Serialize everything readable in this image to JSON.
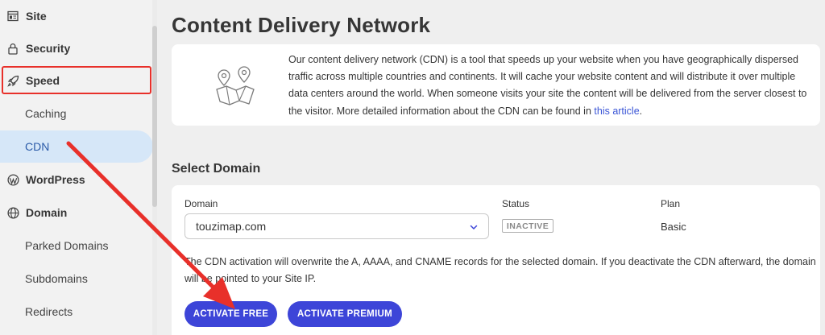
{
  "sidebar": {
    "items": [
      {
        "label": "Site",
        "icon": "site-icon"
      },
      {
        "label": "Security",
        "icon": "lock-icon"
      },
      {
        "label": "Speed",
        "icon": "rocket-icon"
      },
      {
        "label": "Caching"
      },
      {
        "label": "CDN"
      },
      {
        "label": "WordPress",
        "icon": "wordpress-icon"
      },
      {
        "label": "Domain",
        "icon": "globe-icon"
      },
      {
        "label": "Parked Domains"
      },
      {
        "label": "Subdomains"
      },
      {
        "label": "Redirects"
      }
    ],
    "active": "CDN"
  },
  "main": {
    "title": "Content Delivery Network",
    "info": {
      "text": "Our content delivery network (CDN) is a tool that speeds up your website when you have geographically dispersed traffic across multiple countries and continents. It will cache your website content and will distribute it over multiple data centers around the world. When someone visits your site the content will be delivered from the server closest to the visitor. More detailed information about the CDN can be found in ",
      "link": "this article",
      "after_link": ".",
      "illustration": "map-pins-icon"
    },
    "select_domain": {
      "title": "Select Domain",
      "columns": {
        "domain": "Domain",
        "status": "Status",
        "plan": "Plan"
      },
      "domain_value": "touzimap.com",
      "status_value": "INACTIVE",
      "plan_value": "Basic",
      "notice": "The CDN activation will overwrite the A, AAAA, and CNAME records for the selected domain. If you deactivate the CDN afterward, the domain will be pointed to your Site IP.",
      "activate_free_label": "ACTIVATE FREE",
      "activate_premium_label": "ACTIVATE PREMIUM"
    }
  },
  "colors": {
    "accent": "#3d45d8",
    "active_nav_bg": "#d6e7f8",
    "annotation_red": "#e8302a",
    "link": "#3a55d6"
  }
}
